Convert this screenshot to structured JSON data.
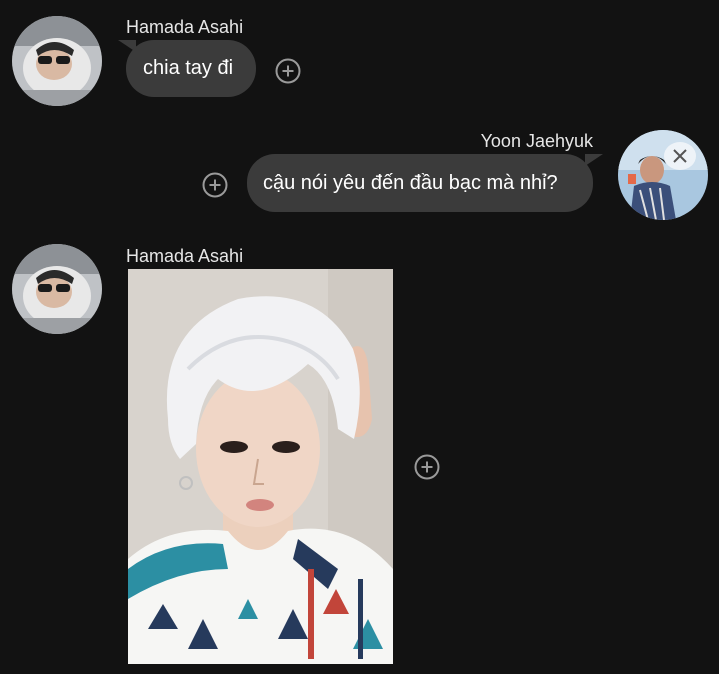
{
  "messages": [
    {
      "sender": "Hamada Asahi",
      "text": "chia tay đi",
      "side": "left"
    },
    {
      "sender": "Yoon Jaehyuk",
      "text": "cậu nói yêu đến đầu bạc mà nhỉ?",
      "side": "right"
    },
    {
      "sender": "Hamada Asahi",
      "attachment": "photo",
      "side": "left"
    }
  ],
  "icons": {
    "add_reaction": "plus-circle-icon"
  },
  "colors": {
    "background": "#121212",
    "bubble": "#3b3b3b",
    "text": "#ffffff",
    "sender_text": "#e6e6e6",
    "icon_stroke": "#9a9a9a"
  }
}
